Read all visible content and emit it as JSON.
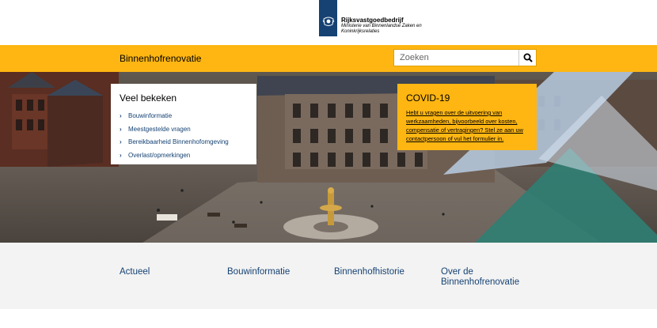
{
  "header": {
    "org_name": "Rijksvastgoedbedrijf",
    "org_sub_line1": "Ministerie van Binnenlandse Zaken en",
    "org_sub_line2": "Koninkrijksrelaties"
  },
  "navbar": {
    "site_title": "Binnenhofrenovatie",
    "search_placeholder": "Zoeken",
    "search_icon": "search-icon"
  },
  "popular": {
    "title": "Veel bekeken",
    "items": [
      {
        "label": "Bouwinformatie"
      },
      {
        "label": "Meestgestelde vragen"
      },
      {
        "label": "Bereikbaarheid Binnenhofomgeving"
      },
      {
        "label": "Overlast/opmerkingen"
      }
    ]
  },
  "covid": {
    "title": "COVID-19",
    "text": "Hebt u vragen over de uitvoering van werkzaamheden, bijvoorbeeld over kosten, compensatie of vertragingen? Stel ze aan uw contactpersoon of vul het formulier in."
  },
  "footer": {
    "links": [
      {
        "label": "Actueel"
      },
      {
        "label": "Bouwinformatie"
      },
      {
        "label": "Binnenhofhistorie"
      },
      {
        "label": "Over de Binnenhofrenovatie"
      }
    ]
  },
  "colors": {
    "accent": "#ffb612",
    "brand_blue": "#154273",
    "footer_bg": "#f3f3f3"
  }
}
